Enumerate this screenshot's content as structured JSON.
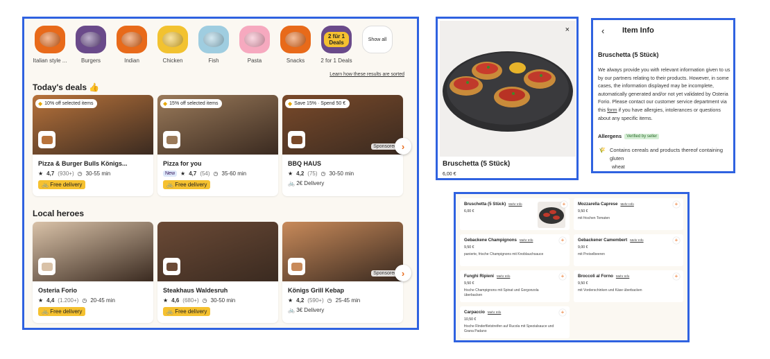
{
  "main": {
    "categories": [
      {
        "label": "Italian style ...",
        "color": "#e86a1a",
        "icon": "pizza-icon"
      },
      {
        "label": "Burgers",
        "color": "#6a4a8a",
        "icon": "burger-icon"
      },
      {
        "label": "Indian",
        "color": "#e86a1a",
        "icon": "curry-icon"
      },
      {
        "label": "Chicken",
        "color": "#f2c230",
        "icon": "chicken-icon"
      },
      {
        "label": "Fish",
        "color": "#9fcde0",
        "icon": "fish-icon"
      },
      {
        "label": "Pasta",
        "color": "#f6a9bf",
        "icon": "pasta-icon"
      },
      {
        "label": "Snacks",
        "color": "#e86a1a",
        "icon": "snacks-icon"
      },
      {
        "label": "2 for 1 Deals",
        "color": "#6a4a8a",
        "badge": "2 für 1 Deals",
        "icon": "deals-icon"
      }
    ],
    "show_all": "Show all",
    "sorted_link": "Learn how these results are sorted",
    "deals_title": "Today's deals 👍",
    "deals": [
      {
        "name": "Pizza & Burger Bulls Königs...",
        "badge": "10% off selected items",
        "rating": "4,7",
        "reviews": "(930+)",
        "time": "30-55 min",
        "delivery": "Free delivery",
        "free": true,
        "new": false,
        "sponsored": false,
        "bg": "#b8733b"
      },
      {
        "name": "Pizza for you",
        "badge": "15% off selected items",
        "rating": "4,7",
        "reviews": "(54)",
        "time": "35-60 min",
        "delivery": "Free delivery",
        "free": true,
        "new": true,
        "new_label": "New",
        "sponsored": false,
        "bg": "#9a7a5a"
      },
      {
        "name": "BBQ HAUS",
        "badge": "Save 15% · Spend 50 €",
        "rating": "4,2",
        "reviews": "(75)",
        "time": "30-50 min",
        "delivery": "2€ Delivery",
        "free": false,
        "new": false,
        "sponsored": true,
        "sponsored_label": "Sponsored",
        "bg": "#7a4a2a"
      }
    ],
    "heroes_title": "Local heroes",
    "heroes": [
      {
        "name": "Osteria Forio",
        "rating": "4,4",
        "reviews": "(1.200+)",
        "time": "20-45 min",
        "delivery": "Free delivery",
        "free": true,
        "sponsored": false,
        "bg": "#d9c2a8"
      },
      {
        "name": "Steakhaus Waldesruh",
        "rating": "4,6",
        "reviews": "(680+)",
        "time": "30-50 min",
        "delivery": "Free delivery",
        "free": true,
        "sponsored": false,
        "bg": "#6b4a36"
      },
      {
        "name": "Königs Grill Kebap",
        "rating": "4,2",
        "reviews": "(590+)",
        "time": "25-45 min",
        "delivery": "3€ Delivery",
        "free": false,
        "sponsored": true,
        "sponsored_label": "Sponsored",
        "bg": "#c88a5a"
      }
    ]
  },
  "item": {
    "title": "Bruschetta (5 Stück)",
    "price": "6,00 €",
    "close": "×"
  },
  "info": {
    "header": "Item Info",
    "title": "Bruschetta (5 Stück)",
    "para_1": "We always provide you with relevant information given to us by our partners relating to their products. However, in some cases, the information displayed may be incomplete, automatically generated and/or not yet validated by Osteria Forio. Please contact our customer service department via this ",
    "form_link": "form",
    "para_2": " if you have allergies, intolerances or questions about any specific items.",
    "allergens_label": "Allergens",
    "verified_label": "Verified by seller",
    "allergen_text": "Contains cereals and products thereof containing gluten",
    "allergen_sub": "wheat"
  },
  "menu": {
    "more_info": "Mehr Info",
    "items": [
      {
        "name": "Bruschetta (5 Stück)",
        "price": "6,00 €",
        "desc": "",
        "image": true
      },
      {
        "name": "Mozzarella Caprese",
        "price": "9,50 €",
        "desc": "mit frischen Tomaten",
        "image": false
      },
      {
        "name": "Gebackene Champignons",
        "price": "9,50 €",
        "desc": "panierte, frische Champignons mit Knoblauchsauce",
        "image": false
      },
      {
        "name": "Gebackener Camembert",
        "price": "9,00 €",
        "desc": "mit Preiselbeeren",
        "image": false
      },
      {
        "name": "Funghi Ripieni",
        "price": "9,50 €",
        "desc": "frische Champignons mit Spinat und Gorgonzola überbacken",
        "image": false
      },
      {
        "name": "Broccoli al Forno",
        "price": "9,50 €",
        "desc": "mit Vorderschinken und Käse überbacken",
        "image": false
      },
      {
        "name": "Carpaccio",
        "price": "10,50 €",
        "desc": "frische Rinderfiletstreifen auf Rucola mit Spezialsauce und Grana Padano",
        "image": false
      }
    ]
  }
}
